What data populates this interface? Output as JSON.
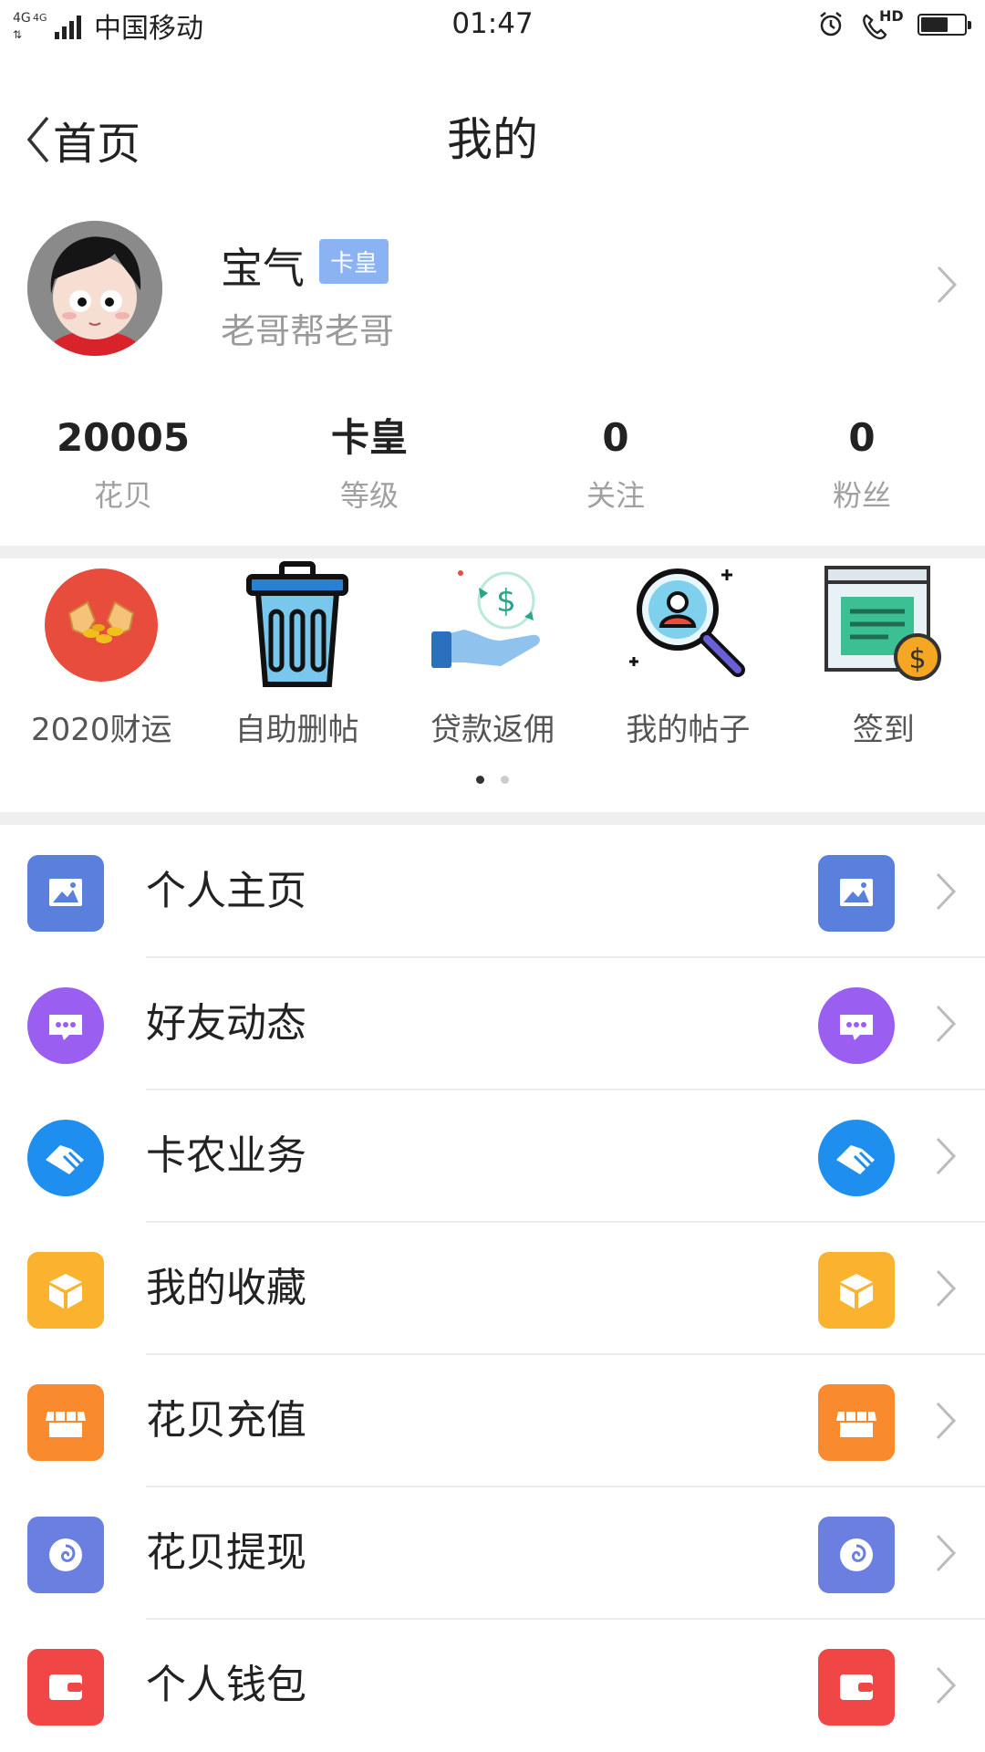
{
  "status_bar": {
    "network": "4G",
    "network2": "4G",
    "carrier": "中国移动",
    "time": "01:47",
    "hd": "HD",
    "battery_level": 0.65
  },
  "nav": {
    "back_label": "首页",
    "title": "我的"
  },
  "profile": {
    "name": "宝气",
    "badge": "卡皇",
    "subtitle": "老哥帮老哥"
  },
  "stats": [
    {
      "value": "20005",
      "label": "花贝"
    },
    {
      "value": "卡皇",
      "label": "等级"
    },
    {
      "value": "0",
      "label": "关注"
    },
    {
      "value": "0",
      "label": "粉丝"
    }
  ],
  "shortcuts": [
    {
      "label": "2020财运",
      "icon": "fortune-icon"
    },
    {
      "label": "自助删帖",
      "icon": "trash-icon"
    },
    {
      "label": "贷款返佣",
      "icon": "loan-rebate-icon"
    },
    {
      "label": "我的帖子",
      "icon": "my-posts-icon"
    },
    {
      "label": "签到",
      "icon": "checkin-icon"
    }
  ],
  "pager": {
    "pages": 2,
    "current": 1
  },
  "menu": [
    {
      "label": "个人主页",
      "icon": "image-icon",
      "color": "#5b7fdc"
    },
    {
      "label": "好友动态",
      "icon": "chat-icon",
      "color": "#9a5ef0"
    },
    {
      "label": "卡农业务",
      "icon": "handshake-icon",
      "color": "#1e8fee"
    },
    {
      "label": "我的收藏",
      "icon": "box-icon",
      "color": "#fbb22e"
    },
    {
      "label": "花贝充值",
      "icon": "shop-icon",
      "color": "#f98a2e"
    },
    {
      "label": "花贝提现",
      "icon": "spiral-icon",
      "color": "#6b7fe0"
    },
    {
      "label": "个人钱包",
      "icon": "wallet-icon",
      "color": "#f04646"
    }
  ]
}
